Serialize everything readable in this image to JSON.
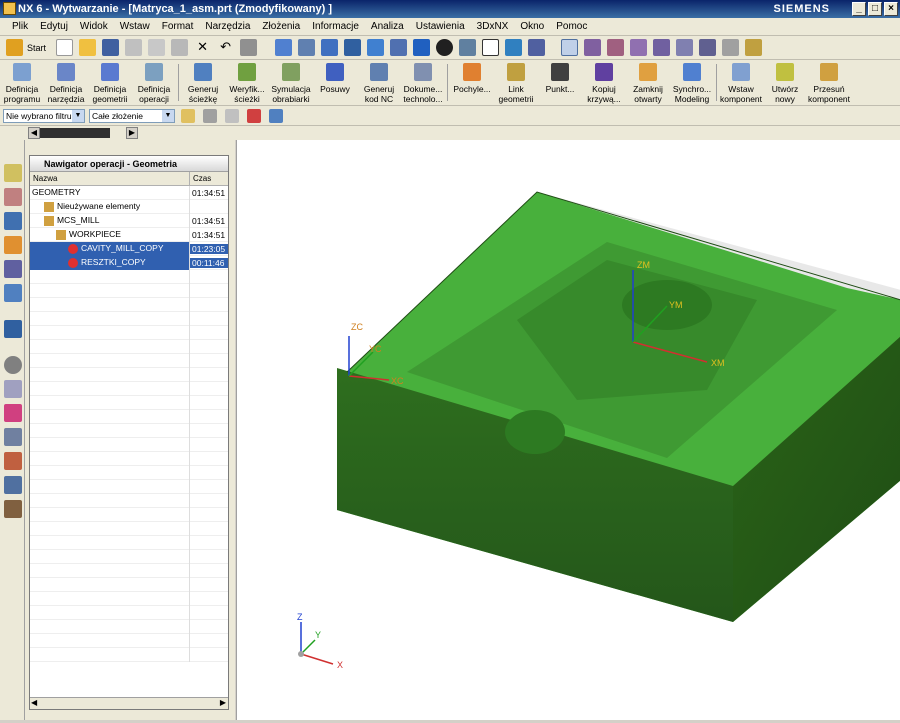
{
  "window": {
    "title": "NX 6 - Wytwarzanie - [Matryca_1_asm.prt (Zmodyfikowany) ]",
    "brand": "SIEMENS"
  },
  "menu": [
    "Plik",
    "Edytuj",
    "Widok",
    "Wstaw",
    "Format",
    "Narzędzia",
    "Złożenia",
    "Informacje",
    "Analiza",
    "Ustawienia",
    "3DxNX",
    "Okno",
    "Pomoc"
  ],
  "toolbar_top": {
    "start_label": "Start"
  },
  "toolbar_main": [
    {
      "label1": "Definicja",
      "label2": "programu",
      "color": "#7ca0d0"
    },
    {
      "label1": "Definicja",
      "label2": "narzędzia",
      "color": "#6a86c8"
    },
    {
      "label1": "Definicja",
      "label2": "geometrii",
      "color": "#5a7ad0"
    },
    {
      "label1": "Definicja",
      "label2": "operacji",
      "color": "#7ca0c0"
    },
    {
      "label1": "Generuj",
      "label2": "ścieżkę",
      "color": "#5080c0"
    },
    {
      "label1": "Weryfik...",
      "label2": "ścieżki",
      "color": "#70a040"
    },
    {
      "label1": "Symulacja",
      "label2": "obrabiarki",
      "color": "#80a060"
    },
    {
      "label1": "Posuwy",
      "label2": "",
      "color": "#4060c0"
    },
    {
      "label1": "Generuj",
      "label2": "kod NC",
      "color": "#6080b0"
    },
    {
      "label1": "Dokume...",
      "label2": "technolo...",
      "color": "#8090b0"
    },
    {
      "label1": "Pochyle...",
      "label2": "",
      "color": "#e08030"
    },
    {
      "label1": "Link",
      "label2": "geometrii",
      "color": "#c0a040"
    },
    {
      "label1": "Punkt...",
      "label2": "",
      "color": "#404040"
    },
    {
      "label1": "Kopiuj",
      "label2": "krzywą...",
      "color": "#6040a0"
    },
    {
      "label1": "Zamknij",
      "label2": "otwarty",
      "color": "#e0a040"
    },
    {
      "label1": "Synchro...",
      "label2": "Modeling",
      "color": "#5080d0"
    },
    {
      "label1": "Wstaw",
      "label2": "komponent",
      "color": "#80a0d0"
    },
    {
      "label1": "Utwórz",
      "label2": "nowy",
      "color": "#c0c040"
    },
    {
      "label1": "Przesuń",
      "label2": "komponent",
      "color": "#d0a040"
    }
  ],
  "filters": {
    "filter_value": "Nie wybrano filtru",
    "scope_value": "Całe złożenie"
  },
  "navigator": {
    "title": "Nawigator operacji - Geometria",
    "col_name": "Nazwa",
    "col_time": "Czas",
    "rows": [
      {
        "name": "GEOMETRY",
        "time": "01:34:51",
        "indent": 0,
        "selected": false
      },
      {
        "name": "Nieużywane elementy",
        "time": "",
        "indent": 1,
        "selected": false
      },
      {
        "name": "MCS_MILL",
        "time": "01:34:51",
        "indent": 1,
        "selected": false
      },
      {
        "name": "WORKPIECE",
        "time": "01:34:51",
        "indent": 2,
        "selected": false
      },
      {
        "name": "CAVITY_MILL_COPY",
        "time": "01:23:05",
        "indent": 3,
        "selected": true
      },
      {
        "name": "RESZTKI_COPY",
        "time": "00:11:46",
        "indent": 3,
        "selected": true
      }
    ]
  },
  "axes": {
    "zc": "ZC",
    "yc": "YC",
    "xc": "XC",
    "zm": "ZM",
    "ym": "YM",
    "xm": "XM",
    "z": "Z",
    "y": "Y",
    "x": "X"
  }
}
